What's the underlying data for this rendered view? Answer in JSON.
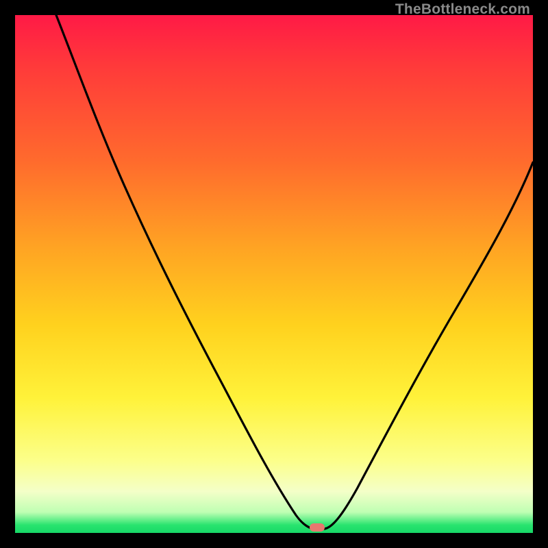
{
  "watermark": "TheBottleneck.com",
  "colors": {
    "curve_stroke": "#000000",
    "marker_fill": "#e7786f",
    "frame": "#000000"
  },
  "chart_data": {
    "type": "line",
    "title": "",
    "xlabel": "",
    "ylabel": "",
    "x_range": [
      0,
      100
    ],
    "y_range": [
      0,
      100
    ],
    "note": "Axes are unlabeled; x and y normalized to 0–100. y is the curve height (0 = bottom/green, 100 = top/red). Minimum of the V-shaped curve is near x≈58.",
    "series": [
      {
        "name": "bottleneck-curve",
        "x": [
          8,
          12,
          18,
          24,
          30,
          36,
          42,
          48,
          53,
          56,
          58,
          60,
          64,
          70,
          76,
          82,
          88,
          94,
          100
        ],
        "y": [
          100,
          90,
          78,
          66,
          55,
          45,
          34,
          22,
          11,
          4,
          1,
          3,
          9,
          20,
          32,
          44,
          55,
          64,
          72
        ]
      }
    ],
    "min_marker": {
      "x": 58,
      "y": 1
    },
    "gradient_stops": [
      {
        "pct": 0,
        "color": "#ff1a46"
      },
      {
        "pct": 28,
        "color": "#ff6a2d"
      },
      {
        "pct": 60,
        "color": "#ffd21e"
      },
      {
        "pct": 86,
        "color": "#fcff8a"
      },
      {
        "pct": 100,
        "color": "#17d867"
      }
    ]
  }
}
